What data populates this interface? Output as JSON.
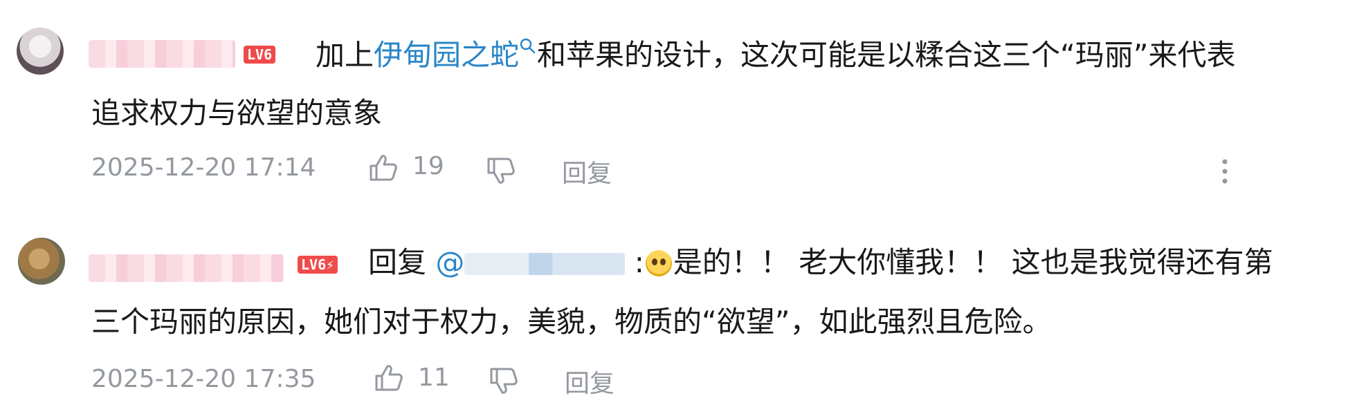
{
  "comments": [
    {
      "level_label": "LV6",
      "text_segments": {
        "prefix": "加上",
        "link": "伊甸园之蛇",
        "after_link": "和苹果的设计，这次可能是以糅合这三个“玛丽”来代表",
        "line2": "追求权力与欲望的意象"
      },
      "timestamp": "2025-12-20 17:14",
      "likes": "19",
      "reply_label": "回复"
    },
    {
      "level_label": "LV6⚡",
      "text_segments": {
        "reply_prefix": "回复",
        "mention_at": "@",
        "colon": ":",
        "line1_after": "是的！！ 老大你懂我！！ 这也是我觉得还有第",
        "line2": "三个玛丽的原因，她们对于权力，美貌，物质的“欲望”，如此强烈且危险。"
      },
      "timestamp": "2025-12-20 17:35",
      "likes": "11",
      "reply_label": "回复"
    }
  ],
  "icons": {
    "like": "thumbs-up-icon",
    "dislike": "thumbs-down-icon",
    "more": "more-vertical-icon",
    "link_search": "search-icon"
  },
  "colors": {
    "link": "#2a86c9",
    "meta": "#9499a0",
    "level_badge": "#ef4b4b"
  }
}
